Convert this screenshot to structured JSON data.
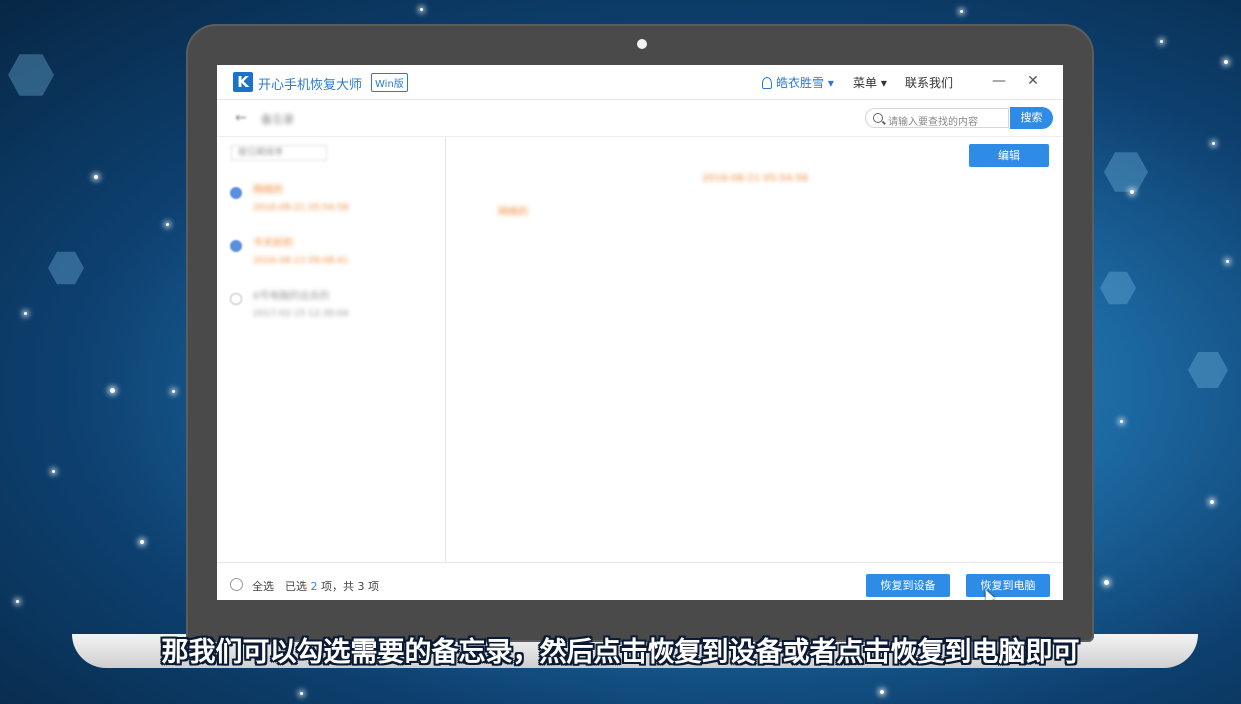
{
  "app": {
    "logo_letter": "K",
    "title": "开心手机恢复大师",
    "edition_badge": "Win版",
    "user_name": "皓衣胜雪",
    "user_caret": "▾",
    "menu_label": "菜单",
    "menu_caret": "▾",
    "contact_label": "联系我们",
    "minimize_glyph": "—",
    "close_glyph": "✕"
  },
  "toolbar": {
    "back_glyph": "←",
    "back_label": "备忘录",
    "search_placeholder": "请输入要查找的内容",
    "search_button": "搜索"
  },
  "notes_list": {
    "sort_label": "按日期排序",
    "items": [
      {
        "title": "网络的",
        "date": "2016-08-21 05:54:58",
        "checked": true
      },
      {
        "title": "今天好的",
        "date": "2016-08-13 09:08:41",
        "checked": true
      },
      {
        "title": "6号电脑的出去的",
        "date": "2017-02-15 12:30:04",
        "checked": false
      }
    ]
  },
  "detail": {
    "edit_button": "编辑",
    "date": "2016-08-21 05:54:58",
    "content": "网络的"
  },
  "footer": {
    "select_all": "全选",
    "selected_prefix": "已选",
    "selected_count": "2",
    "selected_suffix": "项，共 3 项",
    "restore_to_device": "恢复到设备",
    "restore_to_pc": "恢复到电脑"
  },
  "subtitle": "那我们可以勾选需要的备忘录，然后点击恢复到设备或者点击恢复到电脑即可",
  "colors": {
    "accent": "#2e8be6",
    "highlight": "#f08a3a",
    "bezel": "#4a4a4a"
  }
}
